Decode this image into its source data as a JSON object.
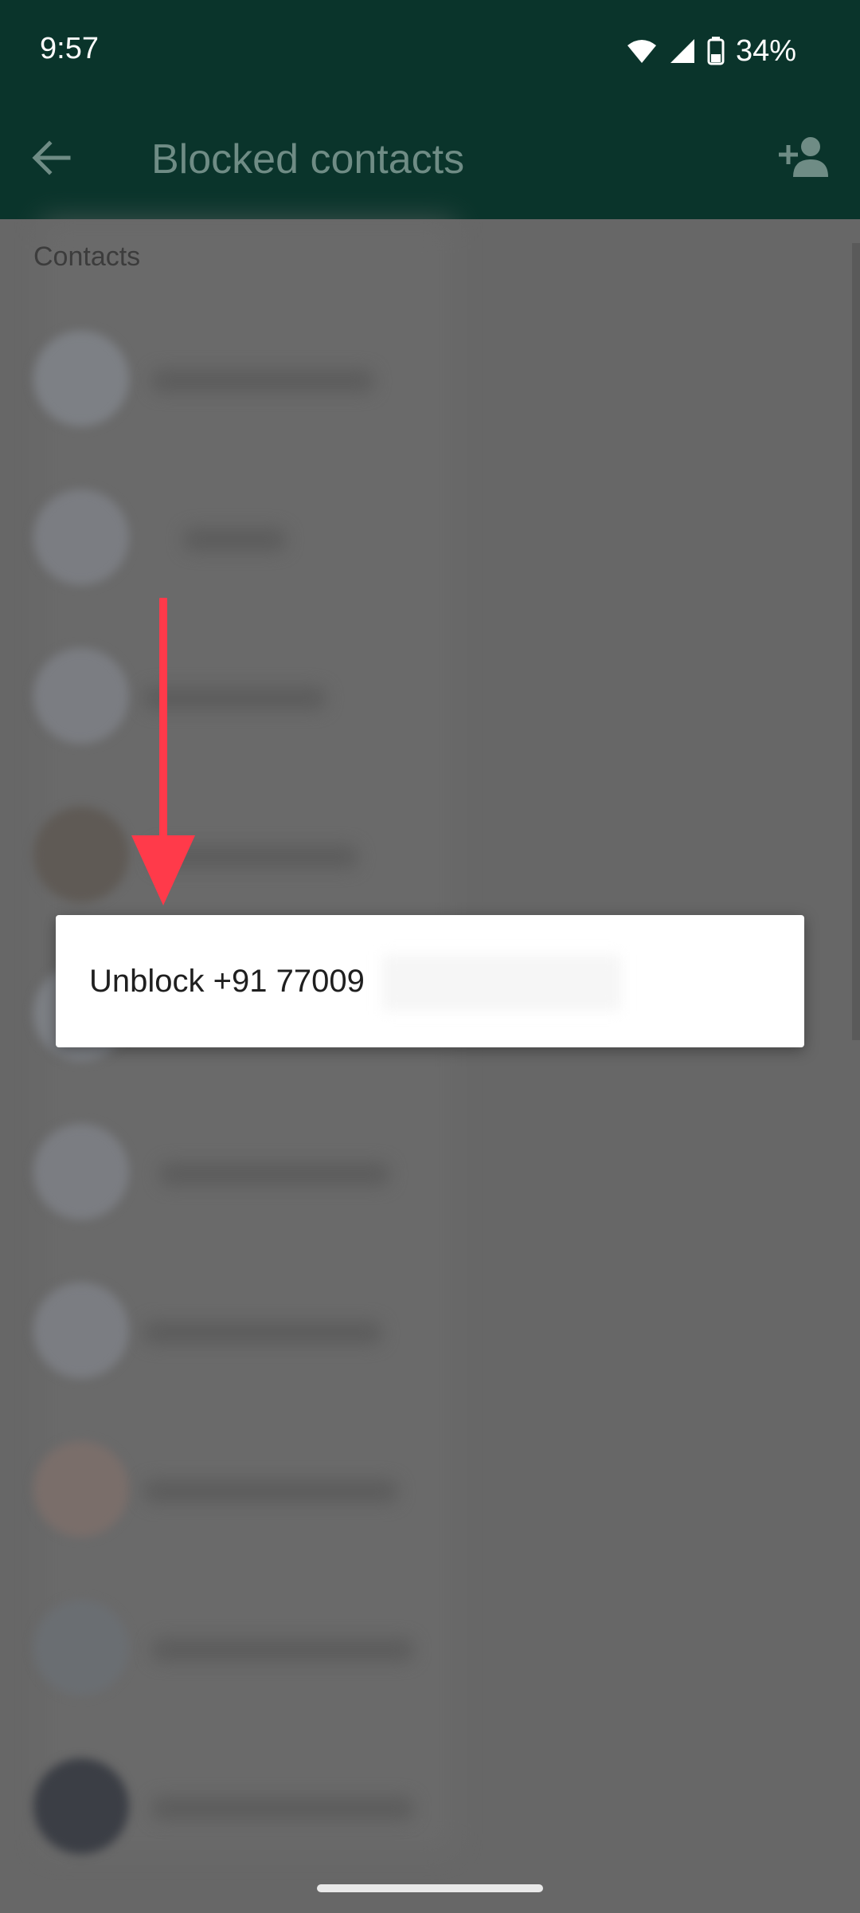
{
  "status_bar": {
    "time": "9:57",
    "battery_percent": "34%"
  },
  "app_bar": {
    "title": "Blocked contacts"
  },
  "list": {
    "section_label": "Contacts",
    "rows": [
      {
        "avatar_color": "#7d8085"
      },
      {
        "avatar_color": "#7b7d82"
      },
      {
        "avatar_color": "#7b7d82"
      },
      {
        "avatar_color": "#5f5a55"
      },
      {
        "avatar_color": "#7d8085"
      },
      {
        "avatar_color": "#7b7d82"
      },
      {
        "avatar_color": "#7b7d82"
      },
      {
        "avatar_color": "#7a6e6a"
      },
      {
        "avatar_color": "#6a6e72"
      },
      {
        "avatar_color": "#3b3e45"
      }
    ]
  },
  "dialog": {
    "option_label": "Unblock +91 77009"
  },
  "colors": {
    "app_bar": "#0a342b",
    "scrim": "#676767",
    "annotation_arrow": "#ff3a4a",
    "dialog_background": "#ffffff"
  }
}
